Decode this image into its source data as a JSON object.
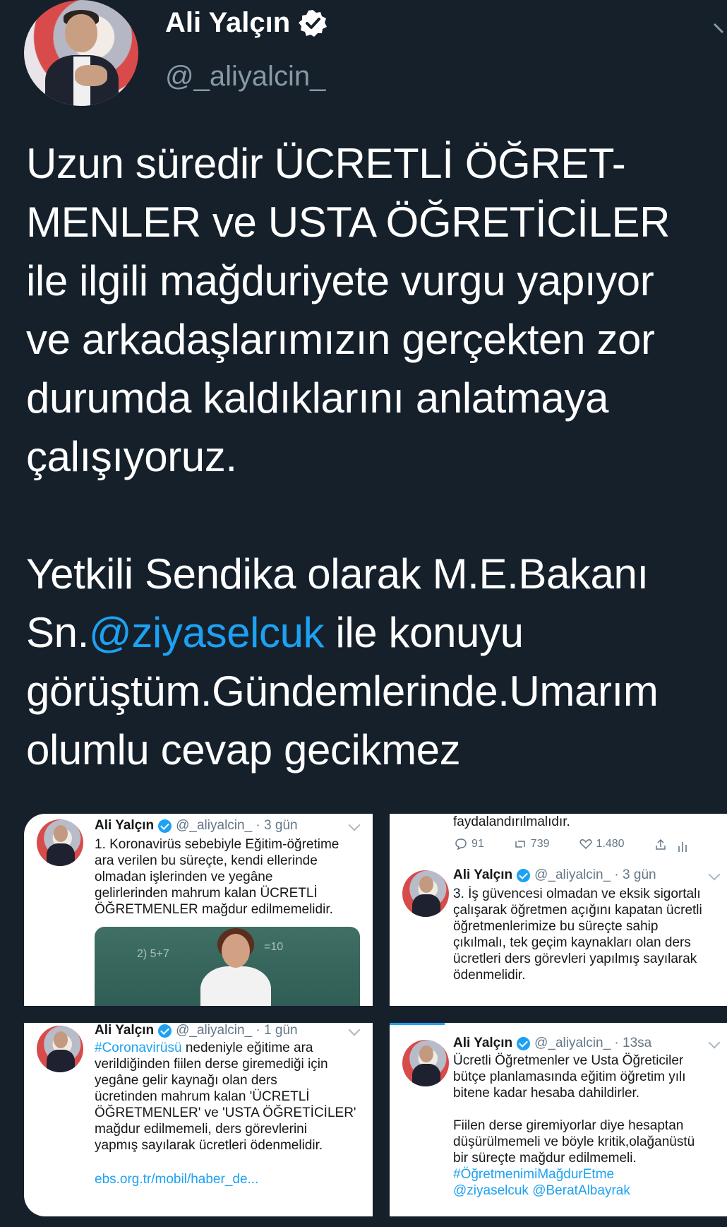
{
  "header": {
    "name": "Ali Yalçın",
    "handle": "@_aliyalcin_"
  },
  "tweet": {
    "line1": "Uzun süredir ÜCRETLİ ÖĞRET-",
    "line2": "MENLER ve USTA ÖĞRETİCİLER",
    "line3": "ile ilgili mağduriyete vurgu yapıyor",
    "line4": "ve arkadaşlarımızın gerçekten zor",
    "line5": "durumda kaldıklarını anlatmaya",
    "line6": "çalışıyoruz.",
    "line7": "Yetkili Sendika olarak M.E.Bakanı",
    "line8_prefix": "Sn.",
    "mention": "@ziyaselcuk",
    "line8_suffix": " ile konuyu",
    "line9": "görüştüm.Gündemlerinde.Umarım",
    "line10": "olumlu cevap gecikmez"
  },
  "cards": {
    "c1": {
      "name": "Ali Yalçın",
      "meta": "@_aliyalcin_ · 3 gün",
      "text": "1. Koronavirüs sebebiyle Eğitim-öğretime\nara verilen bu süreçte, kendi ellerinde\nolmadan işlerinden ve yegâne\ngelirlerinden mahrum kalan ÜCRETLİ\nÖĞRETMENLER mağdur edilmemelidir."
    },
    "c2": {
      "top_text": "faydalandırılmalıdır.",
      "replies": "91",
      "retweets": "739",
      "likes": "1.480",
      "name": "Ali Yalçın",
      "meta": "@_aliyalcin_ · 3 gün",
      "text": "3. İş güvencesi olmadan ve eksik sigortalı\nçalışarak öğretmen açığını kapatan ücretli\nöğretmenlerimize  bu süreçte sahip\nçıkılmalı, tek geçim kaynakları olan ders\nücretleri ders görevleri yapılmış sayılarak\nödenmelidir."
    },
    "c3": {
      "name": "Ali Yalçın",
      "meta": "@_aliyalcin_ · 1 gün",
      "hashtag": "#Coronavirüsü",
      "text_after_hashtag": " nedeniyle eğitime ara",
      "text": "verildiğinden fiilen derse giremediği için\nyegâne gelir kaynağı olan ders\nücretinden mahrum kalan 'ÜCRETLİ\nÖĞRETMENLER' ve 'USTA ÖĞRETİCİLER'\nmağdur edilmemeli, ders görevlerini\nyapmış sayılarak ücretleri ödenmelidir.",
      "link": "ebs.org.tr/mobil/haber_de..."
    },
    "c4": {
      "name": "Ali Yalçın",
      "meta": "@_aliyalcin_ · 13sa",
      "text": "Ücretli Öğretmenler ve Usta Öğreticiler\nbütçe planlamasında eğitim öğretim yılı\nbitene kadar hesaba dahildirler.",
      "text2": "Fiilen derse giremiyorlar diye hesaptan\ndüşürülmemeli ve böyle kritik,olağanüstü\nbir süreçte mağdur edilmemeli.",
      "hashtag": "#ÖğretmenimiMağdurEtme",
      "mentions": "@ziyaselcuk @BeratAlbayrak"
    }
  }
}
